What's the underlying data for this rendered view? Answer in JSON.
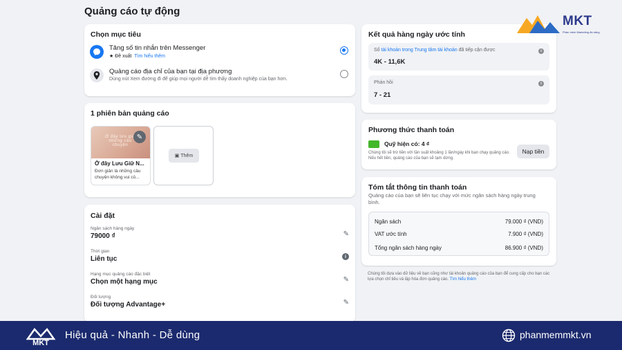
{
  "page_title": "Quảng cáo tự động",
  "goal": {
    "title": "Chọn mục tiêu",
    "options": [
      {
        "title": "Tăng số tin nhắn trên Messenger",
        "badge": "★ Đề xuất",
        "link": "Tìm hiểu thêm",
        "selected": true
      },
      {
        "title": "Quảng cáo địa chỉ của bạn tại địa phương",
        "subtitle": "Dùng nút Xem đường đi để giúp mọi người dễ tìm thấy doanh nghiệp của bạn hơn.",
        "selected": false
      }
    ]
  },
  "versions": {
    "title": "1 phiên bản quảng cáo",
    "ad": {
      "image_text": "Ở đây lưu giữ những câu chuyện",
      "name": "Ở đây Lưu Giữ N...",
      "desc": "Đơn giản là những câu chuyện không vui củ..."
    },
    "add_label": "Thêm"
  },
  "settings": {
    "title": "Cài đặt",
    "rows": [
      {
        "label": "Ngân sách hàng ngày",
        "value": "79000 ₫",
        "icon": "pencil-icon"
      },
      {
        "label": "Thời gian",
        "value": "Liên tục",
        "icon": "info-icon"
      },
      {
        "label": "Hạng mục quảng cáo đặc biệt",
        "value": "Chọn một hạng mục",
        "icon": "pencil-icon"
      },
      {
        "label": "Đối tượng",
        "value": "Đối tượng Advantage+",
        "icon": "pencil-icon"
      }
    ]
  },
  "results": {
    "title": "Kết quả hàng ngày ước tính",
    "reach_prefix": "Số ",
    "reach_link": "tài khoản trong Trung tâm tài khoản",
    "reach_suffix": " đã tiếp cận được",
    "reach_value": "4K - 11,6K",
    "responses_label": "Phản hồi",
    "responses_value": "7 - 21"
  },
  "payment": {
    "title": "Phương thức thanh toán",
    "fund": "Quỹ hiện có: 4 ₫",
    "note": "Chúng tôi sẽ trừ tiền với tần suất khoảng 1 lần/ngày khi bạn chạy quảng cáo. Nếu hết tiền, quảng cáo của bạn sẽ tạm dừng.",
    "topup_label": "Nạp tiền"
  },
  "summary": {
    "title": "Tóm tắt thông tin thanh toán",
    "subtitle": "Quảng cáo của bạn sẽ liên tục chạy với mức ngân sách hàng ngày trung bình.",
    "rows": [
      {
        "label": "Ngân sách",
        "value": "79.000 ₫ (VND)"
      },
      {
        "label": "VAT ước tính",
        "value": "7.900 ₫ (VND)"
      },
      {
        "label": "Tổng ngân sách hàng ngày",
        "value": "86.900 ₫ (VND)"
      }
    ]
  },
  "disclaimer": "Chúng tôi dựa vào dữ liệu về bạn cũng như tài khoản quảng cáo của bạn để cung cấp cho bạn các lựa chọn chỉ tiêu và lập hóa đơn quảng cáo.",
  "disclaimer_link": "Tìm hiểu thêm",
  "brand": {
    "logo_text": "MKT",
    "logo_sub": "Phần mềm Marketing đa năng",
    "tagline": "Hiệu quả - Nhanh - Dễ dùng",
    "website": "phanmemmkt.vn"
  }
}
